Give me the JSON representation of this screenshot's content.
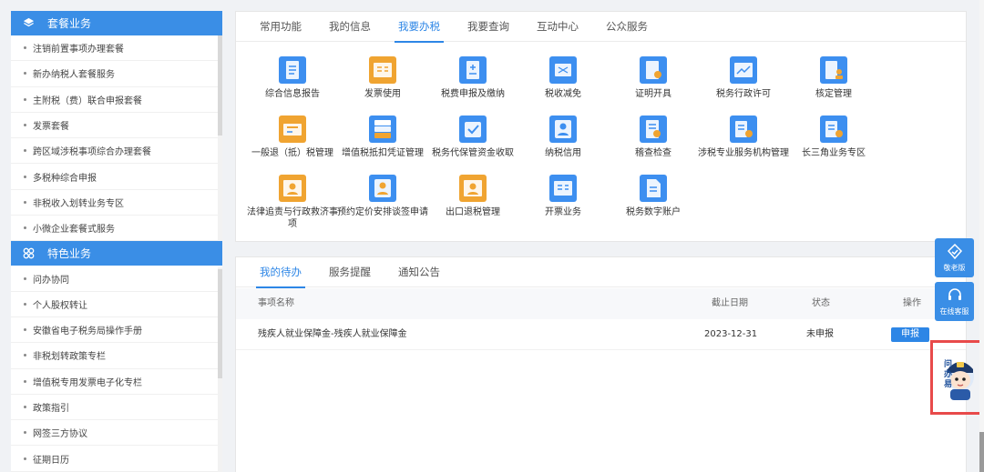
{
  "sidebar": {
    "packages": {
      "title": "套餐业务",
      "items": [
        "注销前置事项办理套餐",
        "新办纳税人套餐服务",
        "主附税（费）联合申报套餐",
        "发票套餐",
        "跨区域涉税事项综合办理套餐",
        "多税种综合申报",
        "非税收入划转业务专区",
        "小微企业套餐式服务"
      ]
    },
    "featured": {
      "title": "特色业务",
      "items": [
        "问办协同",
        "个人股权转让",
        "安徽省电子税务局操作手册",
        "非税划转政策专栏",
        "增值税专用发票电子化专栏",
        "政策指引",
        "网签三方协议",
        "征期日历"
      ]
    }
  },
  "top_tabs": [
    {
      "label": "常用功能",
      "active": false
    },
    {
      "label": "我的信息",
      "active": false
    },
    {
      "label": "我要办税",
      "active": true
    },
    {
      "label": "我要查询",
      "active": false
    },
    {
      "label": "互动中心",
      "active": false
    },
    {
      "label": "公众服务",
      "active": false
    }
  ],
  "services": [
    {
      "label": "综合信息报告",
      "icon": "document-list-icon",
      "color": "#3d8ff0"
    },
    {
      "label": "发票使用",
      "icon": "invoice-icon",
      "color": "#f0a431"
    },
    {
      "label": "税费申报及缴纳",
      "icon": "tax-declaration-icon",
      "color": "#3d8ff0"
    },
    {
      "label": "税收减免",
      "icon": "tax-relief-icon",
      "color": "#3d8ff0"
    },
    {
      "label": "证明开具",
      "icon": "certificate-icon",
      "color": "#3d8ff0"
    },
    {
      "label": "税务行政许可",
      "icon": "license-chart-icon",
      "color": "#3d8ff0"
    },
    {
      "label": "核定管理",
      "icon": "approval-user-icon",
      "color": "#3d8ff0"
    },
    {
      "label": "一般退（抵）税管理",
      "icon": "refund-card-icon",
      "color": "#f0a431"
    },
    {
      "label": "增值税抵扣凭证管理",
      "icon": "voucher-stack-icon",
      "color": "#3d8ff0"
    },
    {
      "label": "税务代保管资金收取",
      "icon": "check-folder-icon",
      "color": "#3d8ff0"
    },
    {
      "label": "纳税信用",
      "icon": "credit-user-icon",
      "color": "#3d8ff0"
    },
    {
      "label": "稽查检查",
      "icon": "inspection-icon",
      "color": "#3d8ff0"
    },
    {
      "label": "涉税专业服务机构管理",
      "icon": "agency-icon",
      "color": "#3d8ff0"
    },
    {
      "label": "长三角业务专区",
      "icon": "region-icon",
      "color": "#3d8ff0"
    },
    {
      "label": "法律追责与行政救济事项",
      "icon": "legal-user-icon",
      "color": "#f0a431"
    },
    {
      "label": "预约定价安排谈签申请",
      "icon": "pricing-user-icon",
      "color": "#3d8ff0"
    },
    {
      "label": "出口退税管理",
      "icon": "export-refund-icon",
      "color": "#f0a431"
    },
    {
      "label": "开票业务",
      "icon": "issue-invoice-icon",
      "color": "#3d8ff0"
    },
    {
      "label": "税务数字账户",
      "icon": "digital-account-icon",
      "color": "#3d8ff0"
    }
  ],
  "todo_tabs": [
    {
      "label": "我的待办",
      "active": true
    },
    {
      "label": "服务提醒",
      "active": false
    },
    {
      "label": "通知公告",
      "active": false
    }
  ],
  "todo_table": {
    "headers": {
      "name": "事项名称",
      "deadline": "截止日期",
      "status": "状态",
      "action": "操作"
    },
    "rows": [
      {
        "name": "残疾人就业保障金-残疾人就业保障金",
        "deadline": "2023-12-31",
        "status": "未申报",
        "action": "申报"
      }
    ]
  },
  "float_tools": {
    "elder": "敬老版",
    "service": "在线客服",
    "mascot": "问办易"
  },
  "colors": {
    "primary": "#3a8ee6",
    "accent": "#f0a431",
    "highlight": "#e84a4a"
  }
}
